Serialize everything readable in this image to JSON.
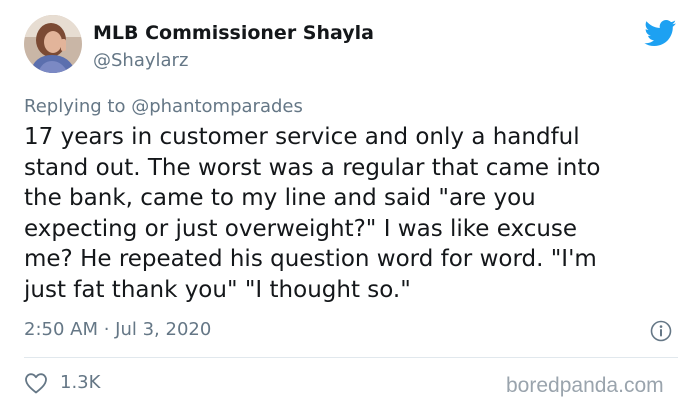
{
  "tweet": {
    "display_name": "MLB Commissioner Shayla",
    "handle": "@Shaylarz",
    "reply_prefix": "Replying to",
    "reply_to": "@phantomparades",
    "text": "17 years in customer service and only a handful\nstand out. The worst was a regular that came into\nthe bank, came to my line and said \"are you\nexpecting or just overweight?\" I was like excuse\nme? He repeated his question word for word. \"I'm\njust fat thank you\" \"I thought so.\"",
    "timestamp": "2:50 AM · Jul 3, 2020",
    "likes": "1.3K"
  },
  "watermark": "boredpanda.com",
  "icons": {
    "brand": "twitter-bird-icon",
    "info": "info-icon",
    "like": "heart-icon"
  },
  "colors": {
    "twitter_blue": "#1da1f2",
    "text": "#14171a",
    "secondary": "#657786",
    "divider": "#e1e8ed"
  }
}
